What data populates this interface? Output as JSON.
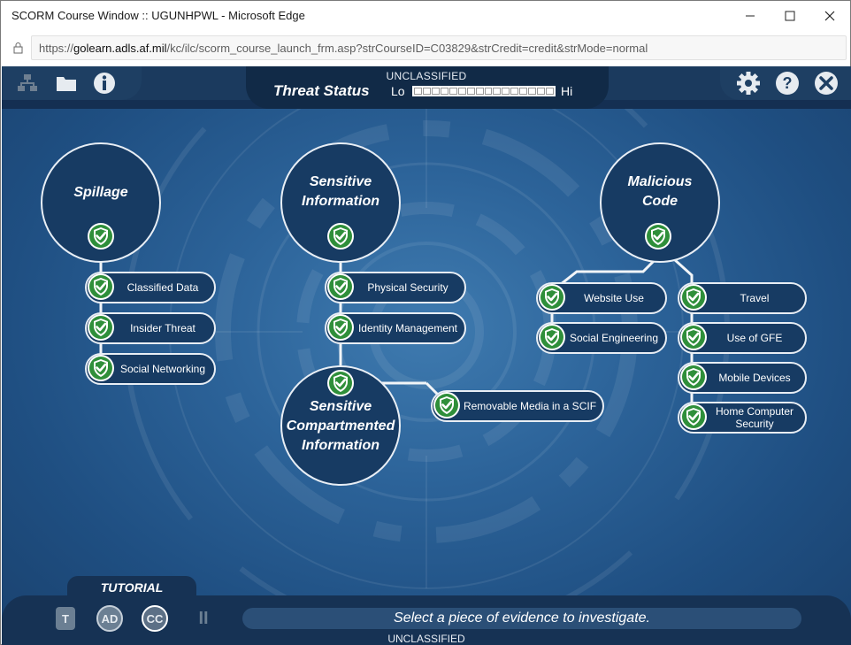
{
  "window": {
    "title": "SCORM Course Window :: UGUNHPWL - Microsoft Edge",
    "url_prefix": "https://",
    "url_host": "golearn.adls.af.mil",
    "url_path": "/kc/ilc/scorm_course_launch_frm.asp?strCourseID=C03829&strCredit=credit&strMode=normal"
  },
  "header": {
    "classification": "UNCLASSIFIED",
    "threat_label": "Threat Status",
    "lo": "Lo",
    "hi": "Hi",
    "threat_level": 0,
    "left_icons": [
      "sitemap-icon",
      "folder-icon",
      "info-icon"
    ],
    "right_icons": [
      "gear-icon",
      "help-icon",
      "close-icon"
    ]
  },
  "categories": {
    "spillage": {
      "title": "Spillage",
      "items": [
        "Classified Data",
        "Insider Threat",
        "Social Networking"
      ]
    },
    "sensitive_info": {
      "title_l1": "Sensitive",
      "title_l2": "Information",
      "items": [
        "Physical Security",
        "Identity Management"
      ]
    },
    "sci": {
      "title_l1": "Sensitive",
      "title_l2": "Compartmented",
      "title_l3": "Information",
      "items": [
        "Removable Media in a SCIF"
      ]
    },
    "malicious": {
      "title_l1": "Malicious",
      "title_l2": "Code",
      "left_items": [
        "Website Use",
        "Social Engineering"
      ],
      "right_items": [
        "Travel",
        "Use of GFE",
        "Mobile Devices",
        "Home Computer Security"
      ]
    }
  },
  "footer": {
    "tutorial": "TUTORIAL",
    "controls": [
      "T",
      "AD",
      "CC",
      "II"
    ],
    "message": "Select a piece of evidence to investigate.",
    "classification": "UNCLASSIFIED"
  },
  "colors": {
    "node_fill": "#173b63",
    "node_border": "#e8eef5",
    "shield_green": "#2f8f3a",
    "background": "#2c6399"
  }
}
